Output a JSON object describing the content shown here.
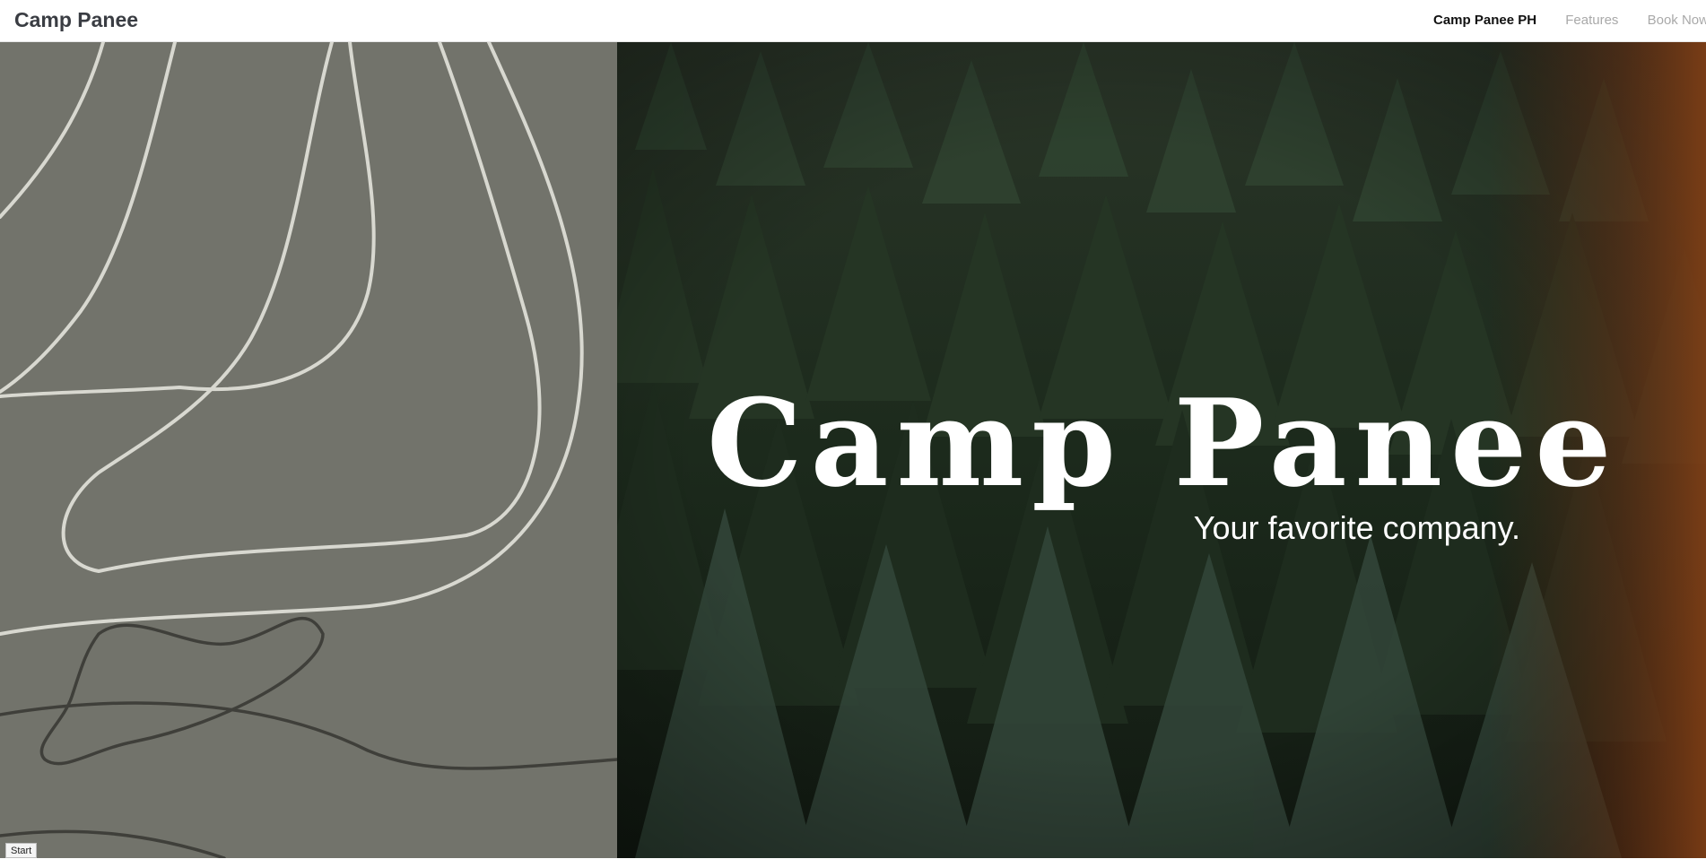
{
  "header": {
    "brand": "Camp Panee",
    "nav": [
      {
        "label": "Camp Panee PH",
        "active": true
      },
      {
        "label": "Features",
        "active": false
      },
      {
        "label": "Book Now",
        "active": false
      }
    ]
  },
  "hero": {
    "title": "Camp Panee",
    "subtitle": "Your favorite company."
  },
  "footer": {
    "start_label": "Start"
  },
  "colors": {
    "left_panel_bg": "#72736b",
    "line_light": "#d8d8d0",
    "line_dark": "#3f3f3a",
    "forest_dark": "#1a2318",
    "brand_text": "#3a3d43"
  },
  "icons": {
    "left_art": "abstract-line-art",
    "right_image": "forest-photo"
  }
}
